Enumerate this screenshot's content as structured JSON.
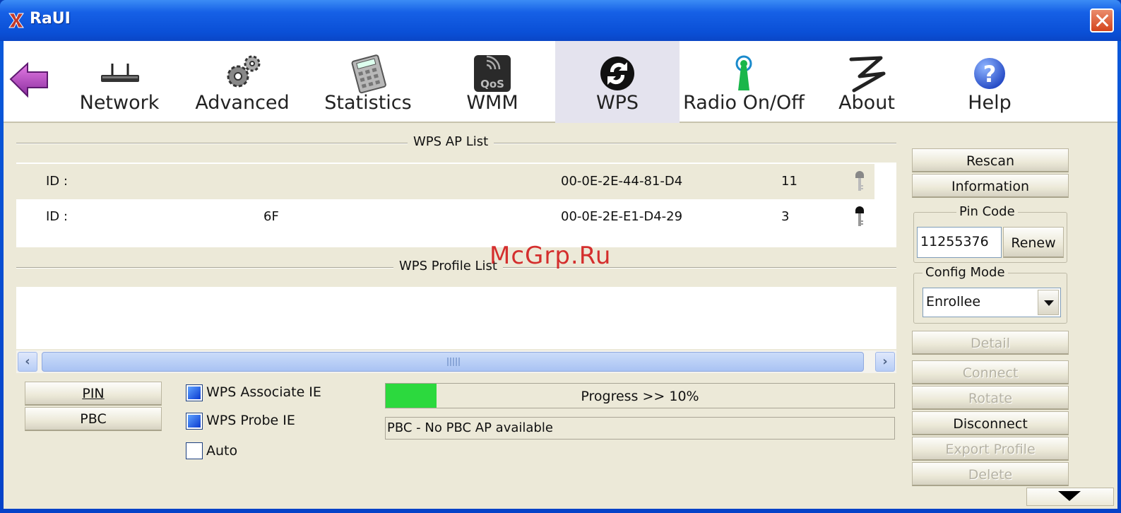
{
  "window": {
    "title": "RaUI"
  },
  "toolbar": {
    "items": [
      {
        "label": "Network",
        "icon": "router-icon"
      },
      {
        "label": "Advanced",
        "icon": "gears-icon"
      },
      {
        "label": "Statistics",
        "icon": "calculator-icon"
      },
      {
        "label": "WMM",
        "icon": "qos-icon"
      },
      {
        "label": "WPS",
        "icon": "wps-icon",
        "active": true
      },
      {
        "label": "Radio On/Off",
        "icon": "antenna-icon"
      },
      {
        "label": "About",
        "icon": "about-logo-icon"
      },
      {
        "label": "Help",
        "icon": "help-icon"
      }
    ]
  },
  "wps_ap_list": {
    "title": "WPS AP List",
    "rows": [
      {
        "id_label": "ID :",
        "name": "",
        "bssid": "00-0E-2E-44-81-D4",
        "channel": "11",
        "selected": true
      },
      {
        "id_label": "ID :",
        "name": "6F",
        "bssid": "00-0E-2E-E1-D4-29",
        "channel": "3",
        "selected": false
      }
    ]
  },
  "wps_profile_list": {
    "title": "WPS Profile List"
  },
  "scrollbar": {
    "grip": "III"
  },
  "left_buttons": {
    "pin": "PIN",
    "pbc": "PBC"
  },
  "options": {
    "associate_ie": {
      "label": "WPS Associate IE",
      "checked": true
    },
    "probe_ie": {
      "label": "WPS Probe IE",
      "checked": true
    },
    "auto": {
      "label": "Auto",
      "checked": false
    }
  },
  "progress": {
    "text": "Progress >> 10%",
    "value": 0.1
  },
  "status": {
    "text": "PBC - No PBC AP available"
  },
  "right_panel": {
    "rescan": "Rescan",
    "information": "Information",
    "pin_code": {
      "legend": "Pin Code",
      "value": "11255376",
      "renew": "Renew"
    },
    "config_mode": {
      "legend": "Config Mode",
      "selected": "Enrollee"
    },
    "detail": "Detail",
    "connect": "Connect",
    "rotate": "Rotate",
    "disconnect": "Disconnect",
    "export_profile": "Export Profile",
    "delete": "Delete"
  },
  "watermark": "McGrp.Ru",
  "colors": {
    "titlebar": "#0a4fd6",
    "progress": "#2cd93e",
    "watermark": "#d21f1f",
    "face": "#ece9d8"
  }
}
